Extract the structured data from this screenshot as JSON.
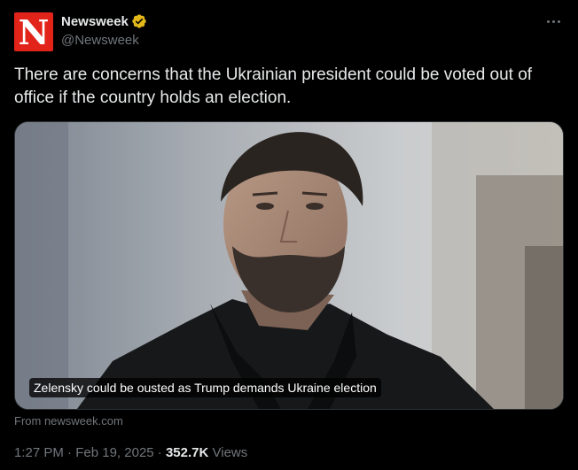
{
  "account": {
    "display_name": "Newsweek",
    "handle": "@Newsweek",
    "avatar_letter": "N",
    "avatar_color": "#e2231a",
    "verified_badge_color": "#e2b719"
  },
  "tweet": {
    "text": "There are concerns that the Ukrainian president could be voted out of office if the country holds an election."
  },
  "card": {
    "caption": "Zelensky could be ousted as Trump demands Ukraine election",
    "source": "From newsweek.com"
  },
  "meta": {
    "time": "1:27 PM",
    "separator": "·",
    "date": "Feb 19, 2025",
    "views_count": "352.7K",
    "views_label": "Views"
  },
  "colors": {
    "background": "#000000",
    "text_primary": "#e7e9ea",
    "text_secondary": "#71767b",
    "border": "#2f3336"
  }
}
